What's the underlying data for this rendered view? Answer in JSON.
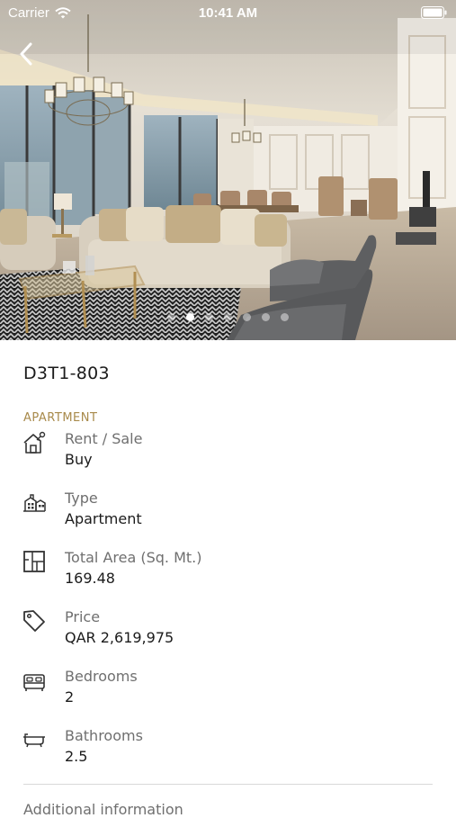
{
  "status_bar": {
    "carrier": "Carrier",
    "time": "10:41 AM"
  },
  "gallery": {
    "dot_count": 7,
    "active_index": 1
  },
  "property": {
    "title": "D3T1-803",
    "category": "APARTMENT",
    "details": [
      {
        "icon": "house-key-icon",
        "label": "Rent / Sale",
        "value": "Buy"
      },
      {
        "icon": "buildings-icon",
        "label": "Type",
        "value": "Apartment"
      },
      {
        "icon": "floor-plan-icon",
        "label": "Total Area (Sq. Mt.)",
        "value": "169.48"
      },
      {
        "icon": "price-tag-icon",
        "label": "Price",
        "value": "QAR 2,619,975"
      },
      {
        "icon": "bed-icon",
        "label": "Bedrooms",
        "value": "2"
      },
      {
        "icon": "bathtub-icon",
        "label": "Bathrooms",
        "value": "2.5"
      }
    ],
    "additional_label": "Additional information"
  }
}
